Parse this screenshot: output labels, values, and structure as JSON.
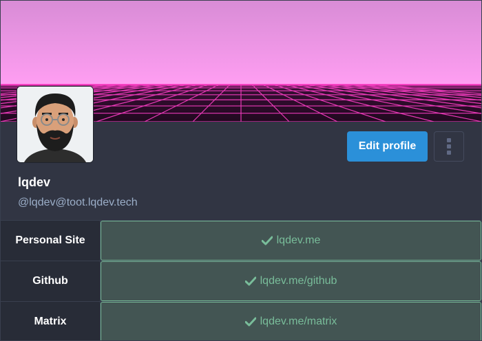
{
  "profile": {
    "display_name": "lqdev",
    "acct": "@lqdev@toot.lqdev.tech",
    "edit_label": "Edit profile",
    "banner_color_top": "#d98fd6",
    "banner_color_horizon": "#ff9ef0",
    "grid_color": "#ff3fc8",
    "fields": [
      {
        "name": "Personal Site",
        "value": "lqdev.me",
        "verified": true
      },
      {
        "name": "Github",
        "value": "lqdev.me/github",
        "verified": true
      },
      {
        "name": "Matrix",
        "value": "lqdev.me/matrix",
        "verified": true
      }
    ]
  },
  "icons": {
    "more": "vertical-ellipsis-icon",
    "verified": "checkmark-icon"
  },
  "colors": {
    "accent": "#2b90d9",
    "verified": "#79bd9a",
    "background": "#313543"
  }
}
